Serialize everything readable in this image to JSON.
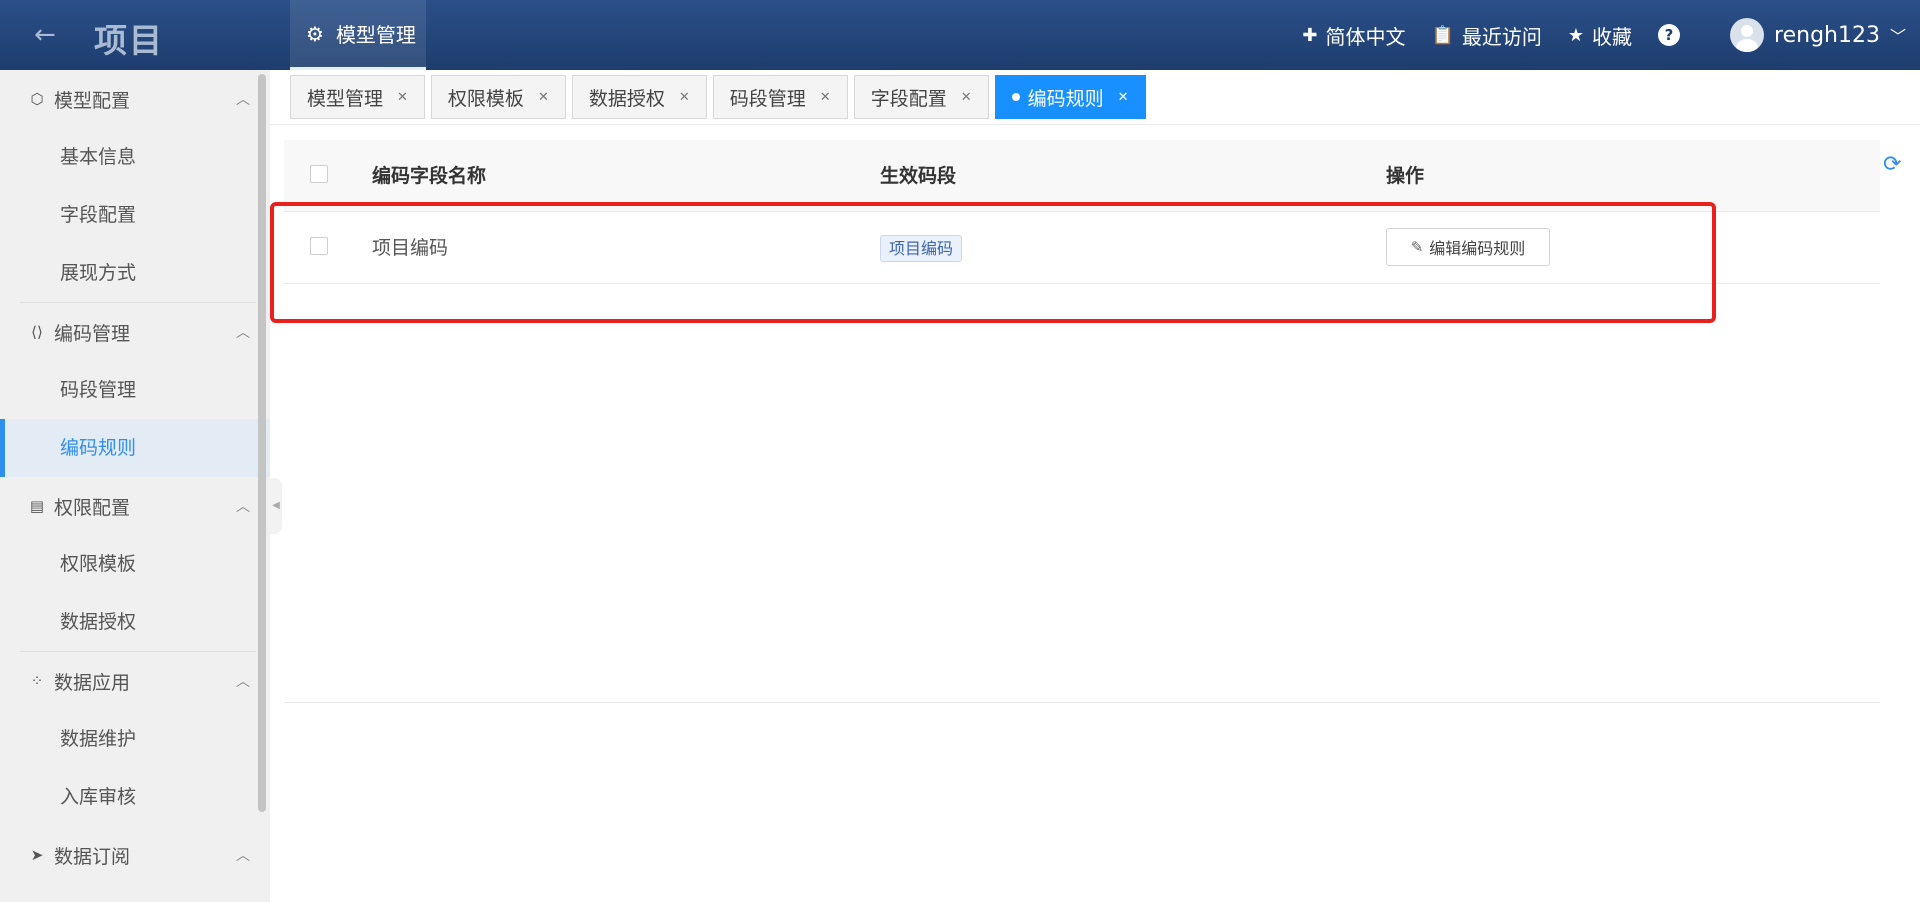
{
  "header": {
    "back_icon": "arrow-left-icon",
    "title": "项目",
    "nav": {
      "label": "模型管理",
      "icon": "gear-icon"
    },
    "language": "简体中文",
    "recent": "最近访问",
    "favorites": "收藏",
    "help": "?",
    "username": "rengh123"
  },
  "sidebar": {
    "groups": [
      {
        "label": "模型配置",
        "icon": "cube-icon",
        "items": [
          "基本信息",
          "字段配置",
          "展现方式"
        ]
      },
      {
        "label": "编码管理",
        "icon": "code-icon",
        "items": [
          "码段管理",
          "编码规则"
        ]
      },
      {
        "label": "权限配置",
        "icon": "permission-doc-icon",
        "items": [
          "权限模板",
          "数据授权"
        ]
      },
      {
        "label": "数据应用",
        "icon": "grid-apps-icon",
        "items": [
          "数据维护",
          "入库审核"
        ]
      },
      {
        "label": "数据订阅",
        "icon": "send-icon",
        "items": []
      }
    ],
    "active_item": "编码规则"
  },
  "tabs": [
    {
      "label": "模型管理",
      "active": false
    },
    {
      "label": "权限模板",
      "active": false
    },
    {
      "label": "数据授权",
      "active": false
    },
    {
      "label": "码段管理",
      "active": false
    },
    {
      "label": "字段配置",
      "active": false
    },
    {
      "label": "编码规则",
      "active": true
    }
  ],
  "table": {
    "columns": [
      "编码字段名称",
      "生效码段",
      "操作"
    ],
    "rows": [
      {
        "name": "项目编码",
        "segment_tag": "项目编码",
        "action": "编辑编码规则"
      }
    ]
  },
  "colors": {
    "header": "#1e3d6e",
    "accent": "#1890ff",
    "highlight": "#e8201e"
  }
}
